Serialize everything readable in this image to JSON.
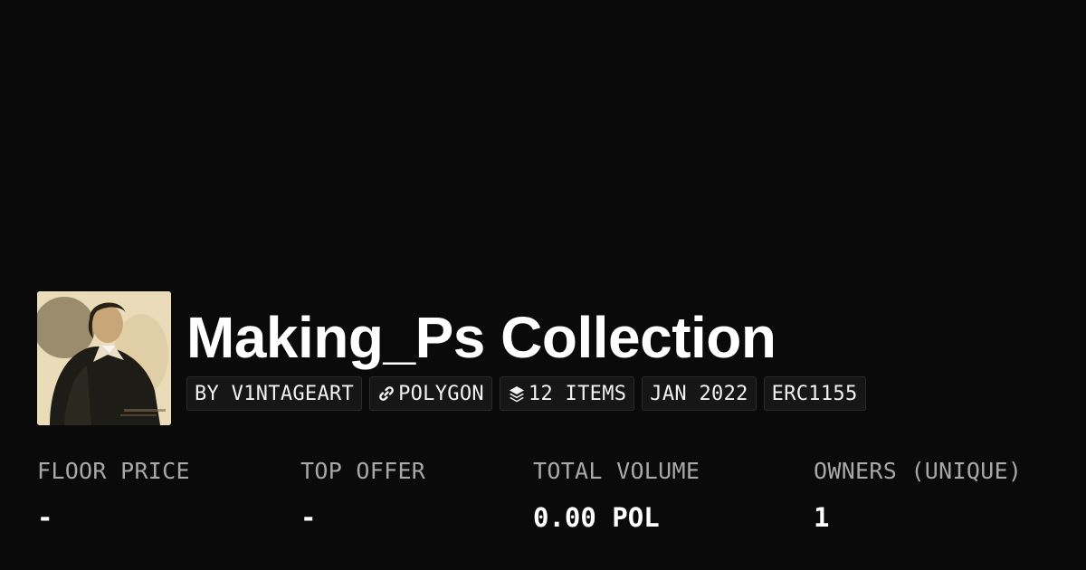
{
  "collection": {
    "title": "Making_Ps Collection",
    "creator_badge": "BY V1NTAGEART",
    "chain_badge": "POLYGON",
    "items_badge": "12 ITEMS",
    "date_badge": "JAN 2022",
    "standard_badge": "ERC1155",
    "chain_icon": "link-icon",
    "items_icon": "layers-icon"
  },
  "stats": [
    {
      "label": "FLOOR PRICE",
      "value": "-"
    },
    {
      "label": "TOP OFFER",
      "value": "-"
    },
    {
      "label": "TOTAL VOLUME",
      "value": "0.00 POL"
    },
    {
      "label": "OWNERS (UNIQUE)",
      "value": "1"
    }
  ],
  "colors": {
    "background": "#0a0a0a",
    "badge_background": "#161616",
    "label": "#a8a8a8",
    "text": "#ffffff"
  }
}
